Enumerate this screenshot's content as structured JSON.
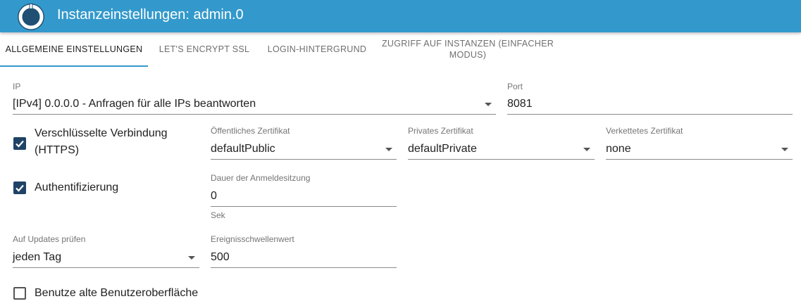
{
  "header": {
    "title": "Instanzeinstellungen: admin.0",
    "logo_icon": "iobroker-logo-icon",
    "background_color": "#3399cc"
  },
  "tabs": [
    {
      "label": "Allgemeine Einstellungen",
      "active": true
    },
    {
      "label": "Let's Encrypt SSL",
      "active": false
    },
    {
      "label": "Login-Hintergrund",
      "active": false
    },
    {
      "label": "Zugriff auf Instanzen (Einfacher Modus)",
      "active": false
    }
  ],
  "form": {
    "ip": {
      "label": "IP",
      "value": "[IPv4] 0.0.0.0 - Anfragen für alle IPs beantworten"
    },
    "port": {
      "label": "Port",
      "value": "8081"
    },
    "https": {
      "label": "Verschlüsselte Verbindung (HTTPS)",
      "checked": true
    },
    "public_cert": {
      "label": "Öffentliches Zertifikat",
      "value": "defaultPublic"
    },
    "private_cert": {
      "label": "Privates Zertifikat",
      "value": "defaultPrivate"
    },
    "chained_cert": {
      "label": "Verkettetes Zertifikat",
      "value": "none"
    },
    "auth": {
      "label": "Authentifizierung",
      "checked": true
    },
    "session_duration": {
      "label": "Dauer der Anmeldesitzung",
      "value": "0",
      "helper": "Sek"
    },
    "updates": {
      "label": "Auf Updates prüfen",
      "value": "jeden Tag"
    },
    "event_threshold": {
      "label": "Ereignisschwellenwert",
      "value": "500"
    },
    "old_ui": {
      "label": "Benutze alte Benutzeroberfläche",
      "checked": false
    }
  },
  "colors": {
    "accent": "#3399cc",
    "checkbox": "#1f4366"
  }
}
